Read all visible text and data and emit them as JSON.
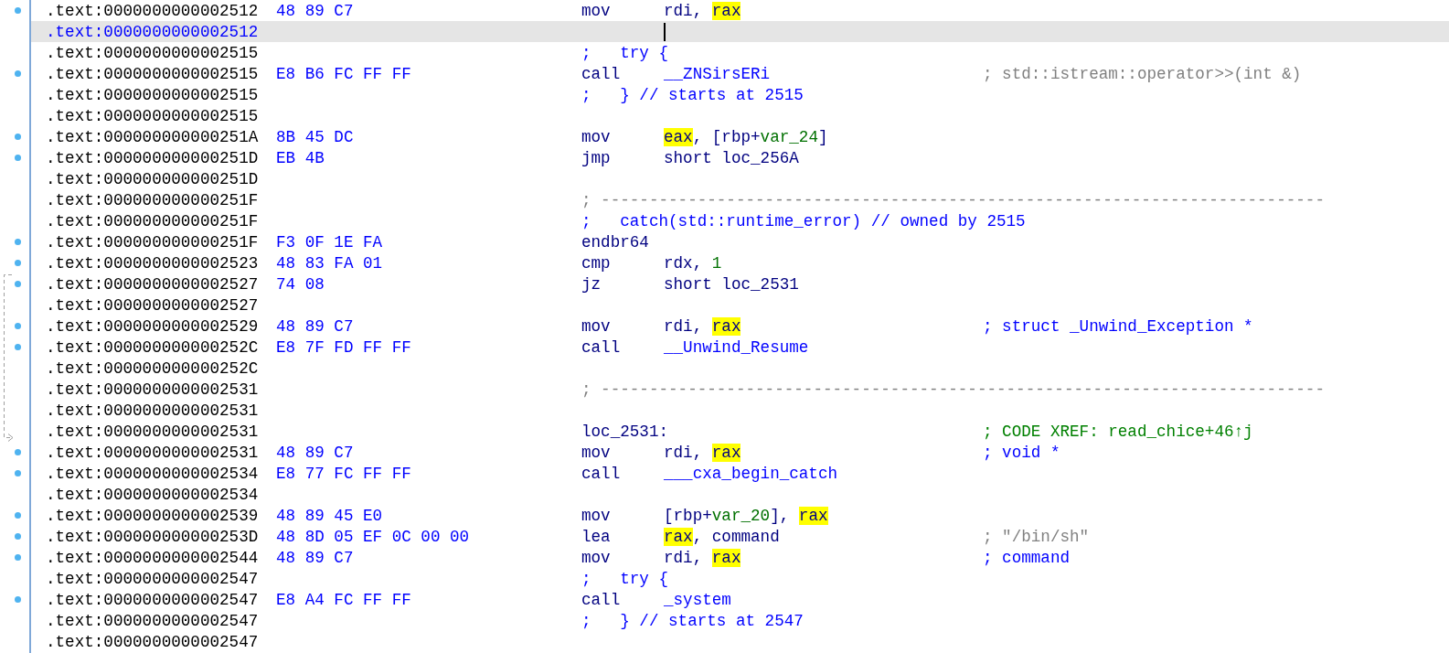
{
  "listing": [
    {
      "address": ".text:0000000000002512",
      "bytes": "48 89 C7",
      "mnemonic": "mov",
      "operands": [
        {
          "text": "rdi, ",
          "kind": "plain"
        },
        {
          "text": "rax",
          "kind": "highlight"
        }
      ],
      "selected": false
    },
    {
      "address": ".text:0000000000002512",
      "selected": true
    },
    {
      "address": ".text:0000000000002515",
      "line": {
        "text": ";   try {",
        "kind": "directive"
      },
      "selected": false
    },
    {
      "address": ".text:0000000000002515",
      "bytes": "E8 B6 FC FF FF",
      "mnemonic": "call",
      "operands": [
        {
          "text": "__ZNSirsERi",
          "kind": "name"
        }
      ],
      "comment": {
        "text": "; std::istream::operator>>(int &)",
        "kind": "auto"
      },
      "selected": false
    },
    {
      "address": ".text:0000000000002515",
      "line": {
        "text": ";   } // starts at 2515",
        "kind": "directive"
      },
      "selected": false
    },
    {
      "address": ".text:0000000000002515",
      "selected": false
    },
    {
      "address": ".text:000000000000251A",
      "bytes": "8B 45 DC",
      "mnemonic": "mov",
      "operands": [
        {
          "text": "eax",
          "kind": "highlight"
        },
        {
          "text": ", [rbp+",
          "kind": "plain"
        },
        {
          "text": "var_24",
          "kind": "var"
        },
        {
          "text": "]",
          "kind": "plain"
        }
      ],
      "selected": false
    },
    {
      "address": ".text:000000000000251D",
      "bytes": "EB 4B",
      "mnemonic": "jmp",
      "operands": [
        {
          "text": "short loc_256A",
          "kind": "plain"
        }
      ],
      "selected": false
    },
    {
      "address": ".text:000000000000251D",
      "selected": false
    },
    {
      "address": ".text:000000000000251F",
      "line": {
        "text": "; ---------------------------------------------------------------------------",
        "kind": "separator"
      },
      "selected": false
    },
    {
      "address": ".text:000000000000251F",
      "line": {
        "text": ";   catch(std::runtime_error) // owned by 2515",
        "kind": "directive"
      },
      "selected": false
    },
    {
      "address": ".text:000000000000251F",
      "bytes": "F3 0F 1E FA",
      "mnemonic": "endbr64",
      "selected": false
    },
    {
      "address": ".text:0000000000002523",
      "bytes": "48 83 FA 01",
      "mnemonic": "cmp",
      "operands": [
        {
          "text": "rdx, ",
          "kind": "plain"
        },
        {
          "text": "1",
          "kind": "number"
        }
      ],
      "selected": false
    },
    {
      "address": ".text:0000000000002527",
      "bytes": "74 08",
      "mnemonic": "jz",
      "operands": [
        {
          "text": "short loc_2531",
          "kind": "plain"
        }
      ],
      "selected": false
    },
    {
      "address": ".text:0000000000002527",
      "selected": false
    },
    {
      "address": ".text:0000000000002529",
      "bytes": "48 89 C7",
      "mnemonic": "mov",
      "operands": [
        {
          "text": "rdi, ",
          "kind": "plain"
        },
        {
          "text": "rax",
          "kind": "highlight"
        }
      ],
      "comment": {
        "text": "; struct _Unwind_Exception *",
        "kind": "type"
      },
      "selected": false
    },
    {
      "address": ".text:000000000000252C",
      "bytes": "E8 7F FD FF FF",
      "mnemonic": "call",
      "operands": [
        {
          "text": "__Unwind_Resume",
          "kind": "name"
        }
      ],
      "selected": false
    },
    {
      "address": ".text:000000000000252C",
      "selected": false
    },
    {
      "address": ".text:0000000000002531",
      "line": {
        "text": "; ---------------------------------------------------------------------------",
        "kind": "separator"
      },
      "selected": false
    },
    {
      "address": ".text:0000000000002531",
      "selected": false
    },
    {
      "address": ".text:0000000000002531",
      "line": {
        "text": "loc_2531:",
        "kind": "label"
      },
      "comment": {
        "text": "; CODE XREF: read_chice+46↑j",
        "kind": "xref"
      },
      "selected": false
    },
    {
      "address": ".text:0000000000002531",
      "bytes": "48 89 C7",
      "mnemonic": "mov",
      "operands": [
        {
          "text": "rdi, ",
          "kind": "plain"
        },
        {
          "text": "rax",
          "kind": "highlight"
        }
      ],
      "comment": {
        "text": "; void *",
        "kind": "type"
      },
      "selected": false
    },
    {
      "address": ".text:0000000000002534",
      "bytes": "E8 77 FC FF FF",
      "mnemonic": "call",
      "operands": [
        {
          "text": "___cxa_begin_catch",
          "kind": "name"
        }
      ],
      "selected": false
    },
    {
      "address": ".text:0000000000002534",
      "selected": false
    },
    {
      "address": ".text:0000000000002539",
      "bytes": "48 89 45 E0",
      "mnemonic": "mov",
      "operands": [
        {
          "text": "[rbp+",
          "kind": "plain"
        },
        {
          "text": "var_20",
          "kind": "var"
        },
        {
          "text": "], ",
          "kind": "plain"
        },
        {
          "text": "rax",
          "kind": "highlight"
        }
      ],
      "selected": false
    },
    {
      "address": ".text:000000000000253D",
      "bytes": "48 8D 05 EF 0C 00 00",
      "mnemonic": "lea",
      "operands": [
        {
          "text": "rax",
          "kind": "highlight"
        },
        {
          "text": ", command",
          "kind": "plain"
        }
      ],
      "comment": {
        "text": "; \"/bin/sh\"",
        "kind": "auto"
      },
      "selected": false
    },
    {
      "address": ".text:0000000000002544",
      "bytes": "48 89 C7",
      "mnemonic": "mov",
      "operands": [
        {
          "text": "rdi, ",
          "kind": "plain"
        },
        {
          "text": "rax",
          "kind": "highlight"
        }
      ],
      "comment": {
        "text": "; command",
        "kind": "type"
      },
      "selected": false
    },
    {
      "address": ".text:0000000000002547",
      "line": {
        "text": ";   try {",
        "kind": "directive"
      },
      "selected": false
    },
    {
      "address": ".text:0000000000002547",
      "bytes": "E8 A4 FC FF FF",
      "mnemonic": "call",
      "operands": [
        {
          "text": "_system",
          "kind": "name"
        }
      ],
      "selected": false
    },
    {
      "address": ".text:0000000000002547",
      "line": {
        "text": ";   } // starts at 2547",
        "kind": "directive"
      },
      "selected": false
    },
    {
      "address": ".text:0000000000002547",
      "selected": false
    }
  ]
}
